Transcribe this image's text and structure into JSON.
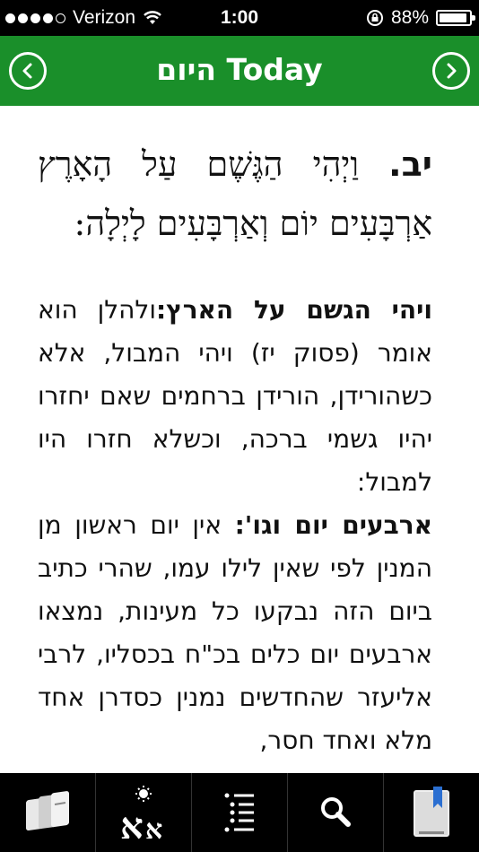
{
  "status_bar": {
    "carrier": "Verizon",
    "time": "1:00",
    "battery": "88%",
    "battery_level": 0.88
  },
  "nav": {
    "title": "היום Today",
    "prev_icon": "chevron-left-circle-icon",
    "next_icon": "chevron-right-circle-icon"
  },
  "verse": {
    "number": "יב.",
    "text": "וַיְהִי הַגֶּשֶׁם עַל הָאָרֶץ אַרְבָּעִים יוֹם וְאַרְבָּעִים לָיְלָה:"
  },
  "commentary": [
    {
      "heading": "ויהי הגשם על הארץ:",
      "text": "ולהלן הוא אומר (פסוק יז) ויהי המבול, אלא כשהורידן, הורידן ברחמים שאם יחזרו יהיו גשמי ברכה, וכשלא חזרו היו למבול:"
    },
    {
      "heading": "ארבעים יום וגו':",
      "text": " אין יום ראשון מן המנין לפי שאין לילו עמו, שהרי כתיב ביום הזה נבקעו כל מעינות, נמצאו ארבעים יום כלים בכ\"ח בכסליו, לרבי אליעזר שהחדשים נמנין כסדרן אחד מלא ואחד חסר,"
    }
  ],
  "toolbar": {
    "items": [
      "books-icon",
      "font-size-icon",
      "list-icon",
      "search-icon",
      "bookmark-icon"
    ]
  }
}
